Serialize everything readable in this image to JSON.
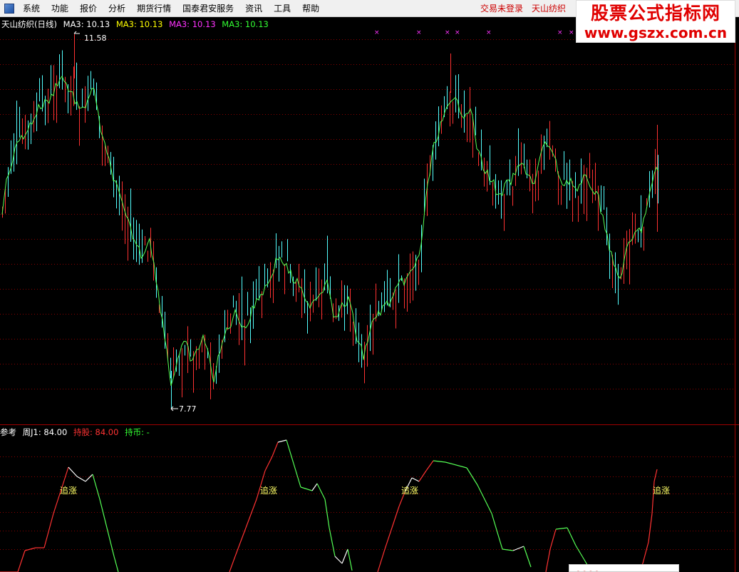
{
  "menu": {
    "items": [
      "系统",
      "功能",
      "报价",
      "分析",
      "期货行情",
      "国泰君安服务",
      "资讯",
      "工具",
      "帮助"
    ],
    "right": [
      "交易未登录",
      "天山纺织"
    ]
  },
  "watermark": {
    "line1": "股票公式指标网",
    "line2": "www.gszx.com.cn"
  },
  "main_legend": {
    "title": "天山纺织(日线)",
    "ma": [
      {
        "label": "MA3: 10.13",
        "color": "#ffffff"
      },
      {
        "label": "MA3: 10.13",
        "color": "#ffff00"
      },
      {
        "label": "MA3: 10.13",
        "color": "#ff33ff"
      },
      {
        "label": "MA3: 10.13",
        "color": "#33ff33"
      }
    ]
  },
  "price_labels": {
    "high": "11.58",
    "low": "7.77"
  },
  "sub_legend": {
    "ref": "参考",
    "zhou": "周J1: 84.00",
    "hold": "持股: 84.00",
    "hold_label": "持股:",
    "cash": "持币: -",
    "cash_label": "持币:"
  },
  "signal_label": "追涨",
  "signals_x": [
    96,
    377,
    575,
    928
  ],
  "colors": {
    "up": "#ff3232",
    "down": "#54ffff",
    "ma": "#55ff55",
    "grid": "#8b0000",
    "white": "#ffffff"
  },
  "chart_data": {
    "type": "candlestick",
    "high": 11.58,
    "low": 7.77,
    "close_series_points": 115,
    "indicator": {
      "name": "周J1",
      "last": 84.0
    }
  },
  "status_icons": [
    "red-icons"
  ]
}
